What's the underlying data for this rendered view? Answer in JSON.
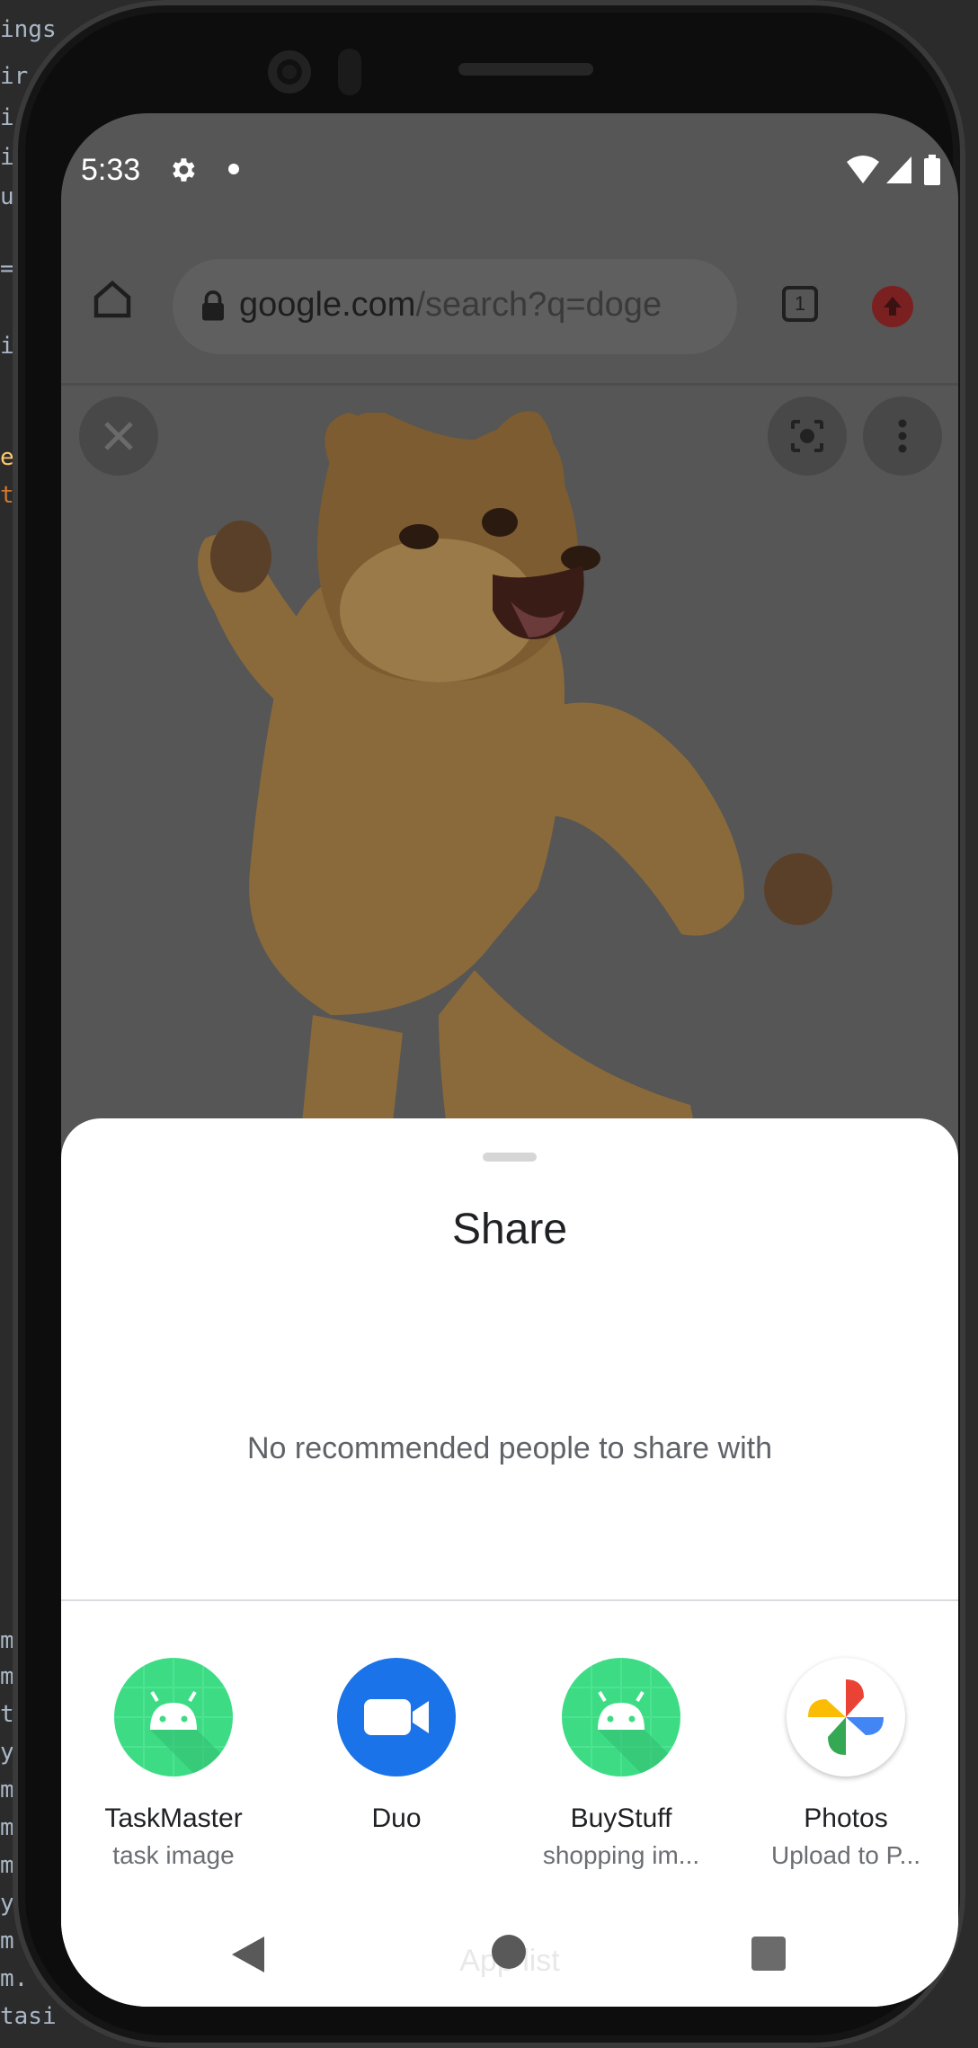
{
  "ide": {
    "left_fragments": [
      "ings",
      "ir",
      "i",
      "i",
      "u",
      "=",
      "i",
      "e",
      "t",
      "m",
      "m",
      "t",
      "y",
      "m",
      "m",
      "m",
      "y",
      "m",
      "m.",
      "tasi"
    ]
  },
  "status_bar": {
    "time": "5:33",
    "icons": [
      "gear-icon",
      "notification-dot",
      "wifi-icon",
      "cell-signal-icon",
      "battery-icon"
    ]
  },
  "browser": {
    "url_host": "google.com",
    "url_path": "/search?q=doge",
    "tab_count": "1"
  },
  "share_sheet": {
    "title": "Share",
    "no_recommendations": "No recommended people to share with",
    "apps": [
      {
        "name": "TaskMaster",
        "subtitle": "task image",
        "icon": "android-icon"
      },
      {
        "name": "Duo",
        "subtitle": "",
        "icon": "duo-video-icon"
      },
      {
        "name": "BuyStuff",
        "subtitle": "shopping im...",
        "icon": "android-icon"
      },
      {
        "name": "Photos",
        "subtitle": "Upload to P...",
        "icon": "photos-pinwheel-icon"
      }
    ],
    "footer_label": "App list"
  },
  "colors": {
    "scrim": "#565656",
    "android_green": "#3ddc84",
    "duo_blue": "#1a73e8"
  }
}
